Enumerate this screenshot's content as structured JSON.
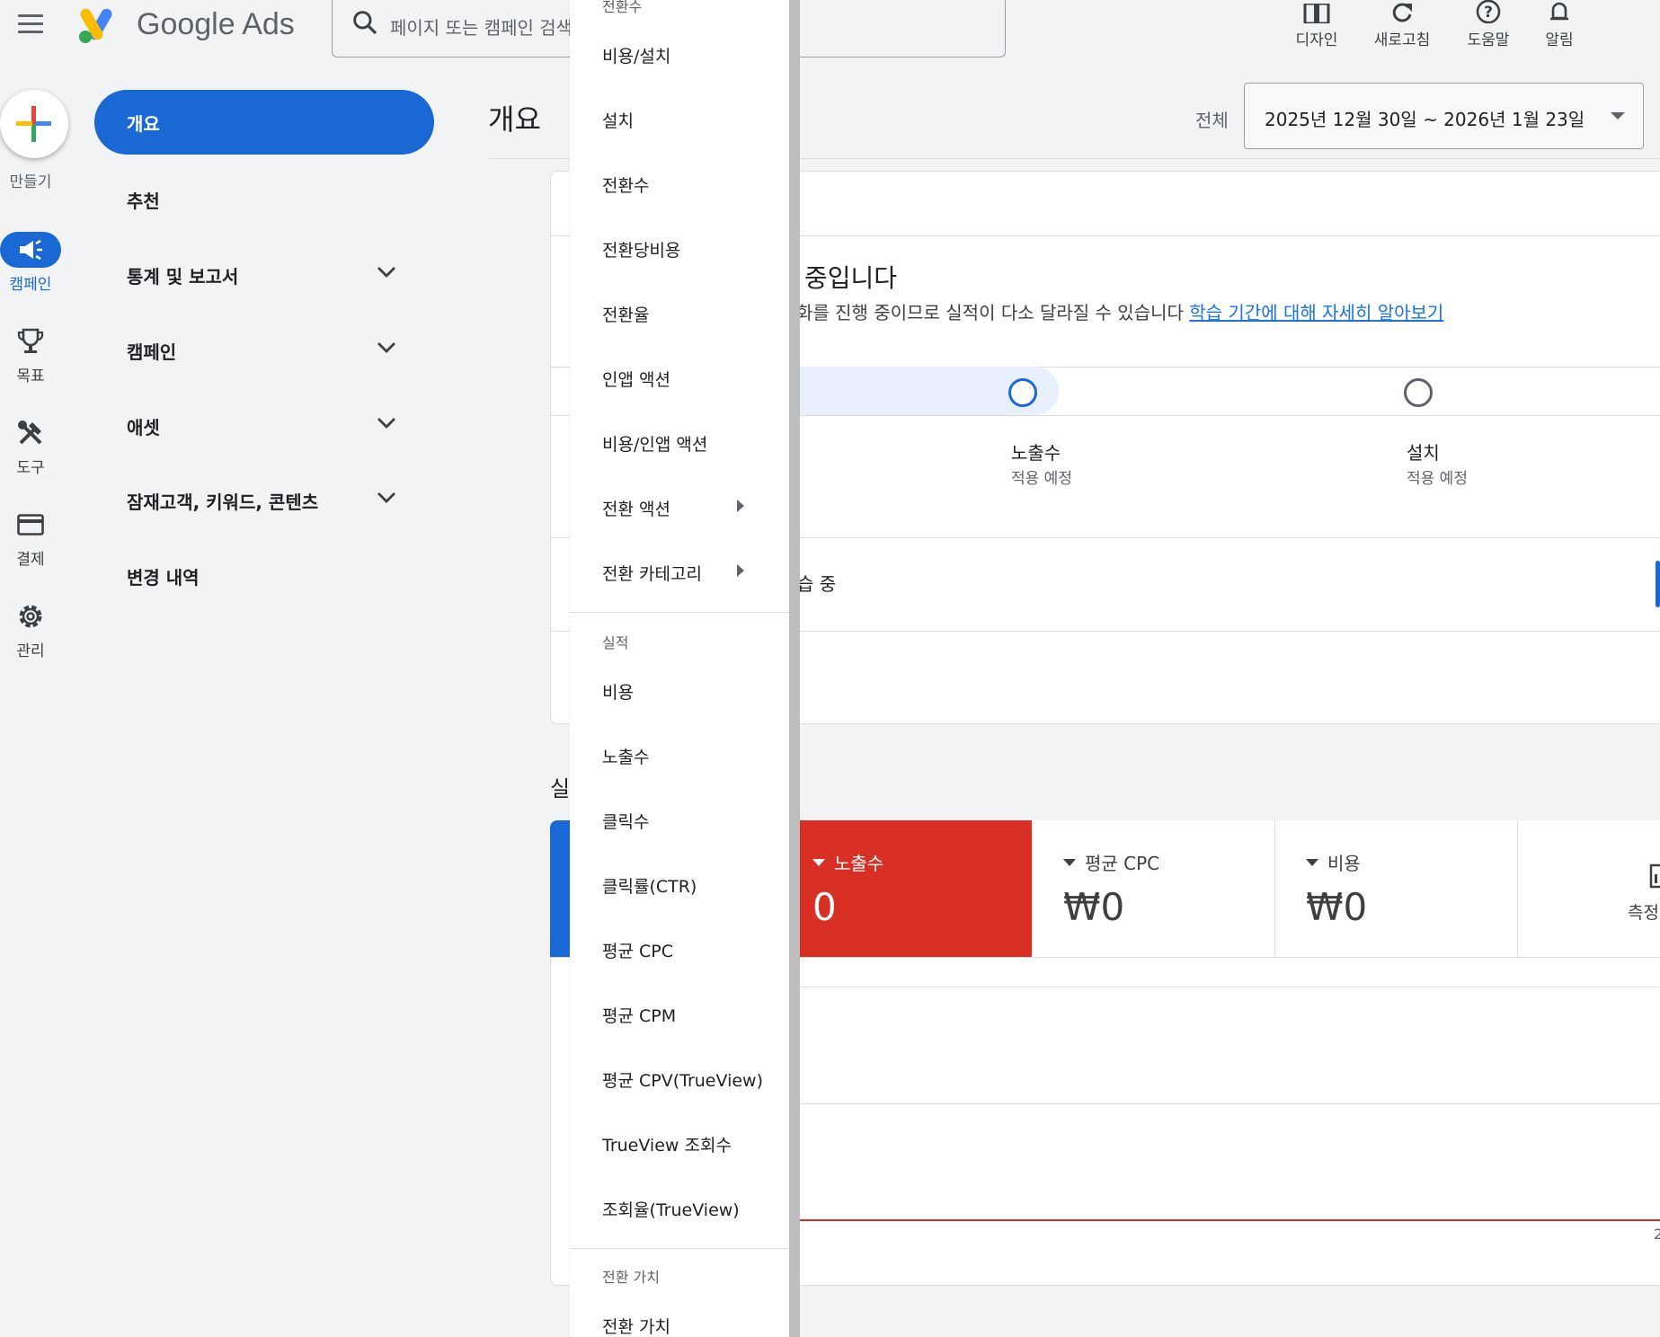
{
  "header": {
    "logo_text": "Google Ads",
    "search_placeholder": "페이지 또는 캠페인 검색",
    "buttons": [
      {
        "label": "디자인",
        "icon": "layout-icon"
      },
      {
        "label": "새로고침",
        "icon": "refresh-icon"
      },
      {
        "label": "도움말",
        "icon": "help-icon"
      },
      {
        "label": "알림",
        "icon": "bell-icon"
      }
    ]
  },
  "rail": {
    "create_label": "만들기",
    "items": [
      {
        "label": "캠페인",
        "icon": "megaphone-icon",
        "active": true
      },
      {
        "label": "목표",
        "icon": "trophy-icon"
      },
      {
        "label": "도구",
        "icon": "tools-icon"
      },
      {
        "label": "결제",
        "icon": "credit-card-icon"
      },
      {
        "label": "관리",
        "icon": "gear-icon"
      }
    ]
  },
  "nav": {
    "active": "개요",
    "items": [
      "추천",
      "통계 및 보고서",
      "캠페인",
      "애셋",
      "잠재고객, 키워드, 콘텐츠",
      "변경 내역"
    ]
  },
  "main": {
    "title": "개요",
    "range_label": "전체",
    "date_range": "2025년 12월 30일 ~ 2026년 1월 23일",
    "learning_title": "중입니다",
    "learning_desc": "화를 진행 중이므로 실적이 다소 달라질 수 있습니다",
    "learning_link": "학습 기간에 대해 자세히 알아보기",
    "steps": [
      {
        "name": "노출수",
        "sub": "적용 예정"
      },
      {
        "name": "설치",
        "sub": "적용 예정"
      }
    ],
    "learning_status": "습 중",
    "perf_label": "실",
    "metrics": [
      {
        "label": "노출수",
        "value": "0"
      },
      {
        "label": "평균 CPC",
        "value": "₩0"
      },
      {
        "label": "비용",
        "value": "₩0"
      }
    ],
    "measure_label": "측정",
    "axis_label": "2",
    "colors": {
      "accent": "#1a68d3",
      "metric_red": "#d93025"
    }
  },
  "menu": {
    "top_header": "전환수",
    "items_a": [
      "비용/설치",
      "설치",
      "전환수",
      "전환당비용",
      "전환율",
      "인앱 액션",
      "비용/인앱 액션"
    ],
    "submenus": [
      "전환 액션",
      "전환 카테고리"
    ],
    "section_perf": "실적",
    "items_b": [
      "비용",
      "노출수",
      "클릭수",
      "클릭률(CTR)",
      "평균 CPC",
      "평균 CPM",
      "평균 CPV(TrueView)",
      "TrueView 조회수",
      "조회율(TrueView)"
    ],
    "section_value": "전환 가치",
    "items_c": [
      "전환 가치"
    ]
  }
}
